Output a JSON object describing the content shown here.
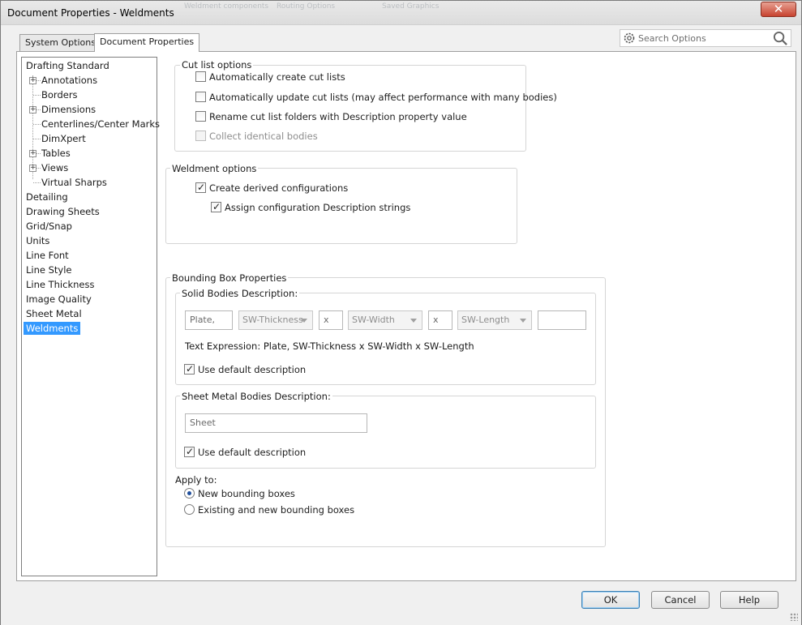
{
  "window": {
    "title": "Document Properties - Weldments",
    "ghost_labels": [
      "Weldment components",
      "Routing Options",
      "Saved Graphics"
    ],
    "close_glyph": "✕"
  },
  "tabs": {
    "system_options": "System Options",
    "document_properties": "Document Properties"
  },
  "search": {
    "placeholder": "Search Options",
    "gear_icon": "gear-icon",
    "search_icon": "magnifier-icon"
  },
  "tree": {
    "items": [
      {
        "label": "Drafting Standard"
      },
      {
        "label": "Annotations"
      },
      {
        "label": "Borders"
      },
      {
        "label": "Dimensions"
      },
      {
        "label": "Centerlines/Center Marks"
      },
      {
        "label": "DimXpert"
      },
      {
        "label": "Tables"
      },
      {
        "label": "Views"
      },
      {
        "label": "Virtual Sharps"
      },
      {
        "label": "Detailing"
      },
      {
        "label": "Drawing Sheets"
      },
      {
        "label": "Grid/Snap"
      },
      {
        "label": "Units"
      },
      {
        "label": "Line Font"
      },
      {
        "label": "Line Style"
      },
      {
        "label": "Line Thickness"
      },
      {
        "label": "Image Quality"
      },
      {
        "label": "Sheet Metal"
      },
      {
        "label": "Weldments"
      }
    ],
    "selected": "Weldments"
  },
  "cut_list": {
    "legend": "Cut list options",
    "auto_create": {
      "label": "Automatically create cut lists",
      "checked": false
    },
    "auto_update": {
      "label": "Automatically update cut lists (may affect performance with many bodies)",
      "checked": false
    },
    "rename_folders": {
      "label": "Rename cut list folders with Description property value",
      "checked": false
    },
    "collect_identical": {
      "label": "Collect identical bodies",
      "checked": false,
      "disabled": true
    }
  },
  "weldment": {
    "legend": "Weldment options",
    "derived_configs": {
      "label": "Create derived configurations",
      "checked": true
    },
    "assign_desc": {
      "label": "Assign configuration Description strings",
      "checked": true
    }
  },
  "bounding_box": {
    "legend": "Bounding Box Properties",
    "solid": {
      "legend": "Solid Bodies Description:",
      "prefix": "Plate,",
      "thickness": "SW-Thickness",
      "sep1": "x",
      "width": "SW-Width",
      "sep2": "x",
      "length": "SW-Length",
      "suffix": "",
      "expression": "Text Expression: Plate, SW-Thickness x SW-Width x SW-Length",
      "use_default": {
        "label": "Use default description",
        "checked": true
      }
    },
    "sheet_metal": {
      "legend": "Sheet Metal Bodies Description:",
      "value": "Sheet",
      "use_default": {
        "label": "Use default description",
        "checked": true
      }
    },
    "apply_to": {
      "label": "Apply to:",
      "options": [
        {
          "label": "New bounding boxes",
          "checked": true
        },
        {
          "label": "Existing and new bounding boxes",
          "checked": false
        }
      ]
    }
  },
  "buttons": {
    "ok": "OK",
    "cancel": "Cancel",
    "help": "Help"
  }
}
